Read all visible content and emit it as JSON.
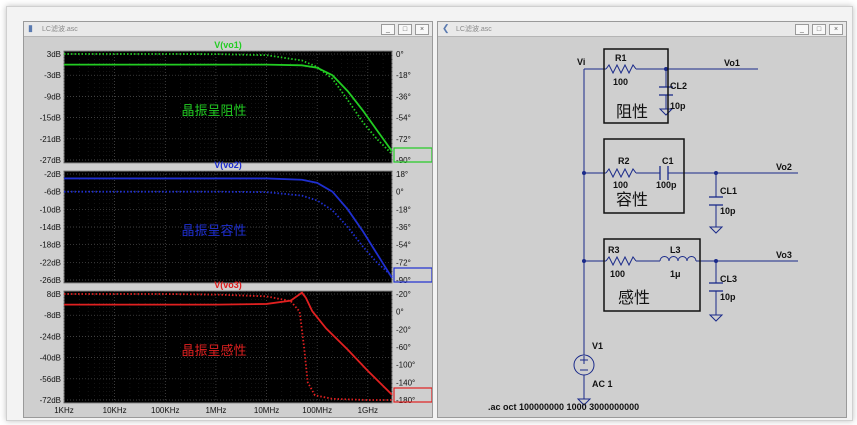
{
  "left_window": {
    "title": "LC滤波.asc",
    "controls": [
      "_",
      "□",
      "×"
    ]
  },
  "right_window": {
    "title": "LC滤波.asc",
    "controls": [
      "_",
      "□",
      "×"
    ]
  },
  "chart_data": [
    {
      "type": "line",
      "title": "V(vo1)",
      "annotation": "晶振呈阻性",
      "color": "#22cc22",
      "y_left_ticks": [
        "3dB",
        "-3dB",
        "-9dB",
        "-15dB",
        "-21dB",
        "-27dB"
      ],
      "y_right_ticks": [
        "0°",
        "-18°",
        "-36°",
        "-54°",
        "-72°",
        "-90°"
      ],
      "ylim_db": [
        -27,
        3
      ],
      "ylim_deg": [
        -90,
        0
      ],
      "x_log": true,
      "xlim_hz": [
        1000,
        3000000000
      ],
      "series": [
        {
          "style": "solid",
          "x": [
            1000,
            10000,
            100000,
            1000000,
            10000000,
            50000000,
            100000000,
            200000000,
            400000000,
            800000000,
            1500000000,
            3000000000
          ],
          "y": [
            0,
            0,
            0,
            0,
            -0.01,
            -0.2,
            -0.9,
            -3,
            -7.5,
            -13,
            -18.5,
            -24.5
          ]
        },
        {
          "style": "dotted",
          "x": [
            1000,
            10000,
            100000,
            1000000,
            10000000,
            50000000,
            100000000,
            200000000,
            400000000,
            800000000,
            1500000000,
            3000000000
          ],
          "y": [
            0,
            0,
            0,
            -0.1,
            -1,
            -5.5,
            -11,
            -21,
            -39,
            -58,
            -72,
            -85
          ]
        }
      ]
    },
    {
      "type": "line",
      "title": "V(vo2)",
      "annotation": "晶振呈容性",
      "color": "#1f2fd0",
      "y_left_ticks": [
        "-2dB",
        "-6dB",
        "-10dB",
        "-14dB",
        "-18dB",
        "-22dB",
        "-26dB"
      ],
      "y_right_ticks": [
        "18°",
        "0°",
        "-18°",
        "-36°",
        "-54°",
        "-72°",
        "-90°"
      ],
      "ylim_db": [
        -26,
        -2
      ],
      "ylim_deg": [
        -90,
        18
      ],
      "x_log": true,
      "xlim_hz": [
        1000,
        3000000000
      ],
      "series": [
        {
          "style": "solid",
          "x": [
            1000,
            10000,
            100000,
            1000000,
            10000000,
            50000000,
            100000000,
            200000000,
            400000000,
            800000000,
            1500000000,
            3000000000
          ],
          "y": [
            -3,
            -3,
            -3,
            -3,
            -3,
            -3.3,
            -4,
            -6,
            -10,
            -15,
            -20,
            -25.5
          ]
        },
        {
          "style": "dotted",
          "x": [
            1000,
            10000,
            100000,
            1000000,
            10000000,
            50000000,
            100000000,
            200000000,
            400000000,
            800000000,
            1500000000,
            3000000000
          ],
          "y": [
            0,
            0,
            0,
            0,
            -0.5,
            -4,
            -9,
            -19,
            -36,
            -56,
            -72,
            -86
          ]
        }
      ]
    },
    {
      "type": "line",
      "title": "V(vo3)",
      "annotation": "晶振呈感性",
      "color": "#e02020",
      "y_left_ticks": [
        "8dB",
        "-8dB",
        "-24dB",
        "-40dB",
        "-56dB",
        "-72dB"
      ],
      "y_right_ticks": [
        "-20°",
        "0°",
        "-20°",
        "-60°",
        "-100°",
        "-140°",
        "-180°"
      ],
      "ylim_db": [
        -72,
        8
      ],
      "ylim_deg": [
        -180,
        0
      ],
      "x_log": true,
      "xlim_hz": [
        1000,
        3000000000
      ],
      "x_ticks": [
        "1KHz",
        "10KHz",
        "100KHz",
        "1MHz",
        "10MHz",
        "100MHz",
        "1GHz"
      ],
      "series": [
        {
          "style": "solid",
          "x": [
            1000,
            10000,
            100000,
            1000000,
            10000000,
            30000000,
            50000000,
            60000000,
            80000000,
            150000000,
            400000000,
            1000000000,
            3000000000
          ],
          "y": [
            0,
            0,
            0,
            0,
            0.5,
            3,
            9,
            5,
            -5,
            -18,
            -34,
            -50,
            -68
          ]
        },
        {
          "style": "dotted",
          "x": [
            1000,
            10000,
            100000,
            1000000,
            10000000,
            30000000,
            45000000,
            55000000,
            65000000,
            90000000,
            200000000,
            1000000000,
            3000000000
          ],
          "y": [
            0,
            0,
            0,
            -1,
            -4,
            -12,
            -30,
            -90,
            -150,
            -172,
            -178,
            -180,
            -180
          ]
        }
      ]
    }
  ],
  "schematic": {
    "labels": {
      "vi": "Vi",
      "r1": "R1",
      "r1_val": "100",
      "cl2": "CL2",
      "cl2_val": "10p",
      "vo1": "Vo1",
      "box1": "阻性",
      "r2": "R2",
      "r2_val": "100",
      "c1": "C1",
      "c1_val": "100p",
      "cl1": "CL1",
      "cl1_val": "10p",
      "vo2": "Vo2",
      "box2": "容性",
      "r3": "R3",
      "r3_val": "100",
      "l3": "L3",
      "l3_val": "1μ",
      "cl3": "CL3",
      "cl3_val": "10p",
      "vo3": "Vo3",
      "box3": "感性",
      "v1": "V1",
      "ac": "AC 1",
      "directive": ".ac oct 100000000 1000 3000000000"
    }
  }
}
